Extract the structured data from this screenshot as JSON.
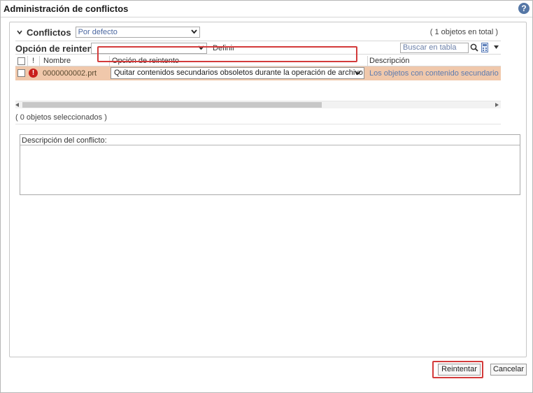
{
  "window": {
    "title": "Administración de conflictos"
  },
  "conflicts": {
    "label": "Conflictos",
    "filter_value": "Por defecto",
    "total_label": "( 1 objetos en total )"
  },
  "retry_bar": {
    "label": "Opción de reintento",
    "select_value": "",
    "define_label": "Definir",
    "search_placeholder": "Buscar en tabla"
  },
  "table": {
    "columns": {
      "flag": "!",
      "name": "Nombre",
      "retry_option": "Opción de reintento",
      "description": "Descripción"
    },
    "rows": [
      {
        "name": "0000000002.prt",
        "retry_option": "Quitar contenidos secundarios obsoletos durante la operación de archivo",
        "description": "Los objetos con contenido secundario obsol"
      }
    ]
  },
  "selection": {
    "count_label": "( 0 objetos seleccionados )"
  },
  "description_panel": {
    "label": "Descripción del conflicto:"
  },
  "buttons": {
    "retry": "Reintentar",
    "cancel": "Cancelar"
  },
  "icons": {
    "help": "help-icon",
    "chevron": "chevron-down-icon",
    "error": "error-icon",
    "search": "search-icon",
    "calculator": "calculator-icon"
  },
  "colors": {
    "row_highlight": "#f0c8ab",
    "error": "#c9201c",
    "callout_border": "#d33b3b",
    "link": "#5c7bb0"
  }
}
